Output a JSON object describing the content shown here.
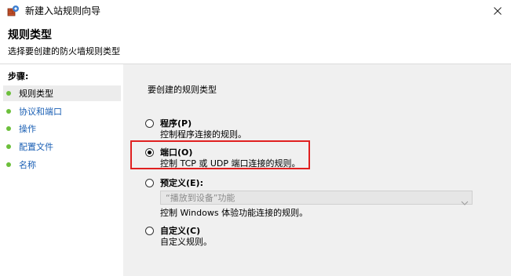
{
  "window": {
    "title": "新建入站规则向导"
  },
  "header": {
    "title": "规则类型",
    "subtitle": "选择要创建的防火墙规则类型"
  },
  "sidebar": {
    "steps_label": "步骤:",
    "items": [
      {
        "label": "规则类型"
      },
      {
        "label": "协议和端口"
      },
      {
        "label": "操作"
      },
      {
        "label": "配置文件"
      },
      {
        "label": "名称"
      }
    ]
  },
  "main": {
    "prompt": "要创建的规则类型",
    "options": [
      {
        "label": "程序(P)",
        "description": "控制程序连接的规则。",
        "selected": false
      },
      {
        "label": "端口(O)",
        "description": "控制 TCP 或 UDP 端口连接的规则。",
        "selected": true
      },
      {
        "label": "预定义(E):",
        "description": "控制 Windows 体验功能连接的规则。",
        "selected": false
      },
      {
        "label": "自定义(C)",
        "description": "自定义规则。",
        "selected": false
      }
    ],
    "predefined_combo": {
      "value": "“播放到设备”功能"
    }
  },
  "colors": {
    "step_dot": "#6cbf3b",
    "link": "#1a5fb4",
    "highlight": "#e02020",
    "panel_bg": "#f0f0f0"
  }
}
